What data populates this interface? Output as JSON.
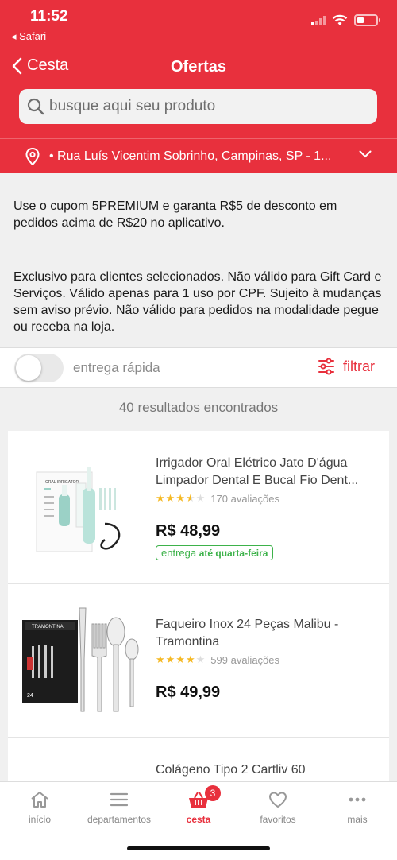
{
  "status_bar": {
    "time": "11:52",
    "back_app": "◂ Safari"
  },
  "nav": {
    "back_label": "Cesta",
    "title": "Ofertas"
  },
  "search": {
    "placeholder": "busque aqui seu produto"
  },
  "address": {
    "text": "•  Rua Luís Vicentim Sobrinho, Campinas, SP - 1..."
  },
  "promo": {
    "line1": "Use o cupom 5PREMIUM e garanta R$5 de desconto em pedidos acima de R$20 no aplicativo.",
    "line2": "Exclusivo para clientes selecionados. Não válido para Gift Card e Serviços. Válido apenas para 1 uso por CPF. Sujeito à mudanças sem aviso prévio. Não válido para pedidos na modalidade pegue ou receba na loja."
  },
  "filter": {
    "toggle_label": "entrega rápida",
    "filter_label": "filtrar",
    "toggle_on": false
  },
  "results_text": "40 resultados encontrados",
  "products": [
    {
      "name": "Irrigador Oral Elétrico Jato D'água Limpador Dental E Bucal Fio Dent...",
      "rating": 3.5,
      "reviews": "170 avaliações",
      "price": "R$ 48,99",
      "delivery_prefix": "entrega",
      "delivery_when": "até quarta-feira"
    },
    {
      "name": "Faqueiro Inox 24 Peças Malibu - Tramontina",
      "rating": 4,
      "reviews": "599 avaliações",
      "price": "R$ 49,99"
    },
    {
      "name": "Colágeno Tipo 2 Cartliv 60"
    }
  ],
  "box_label": "ORAL IRRIGATOR",
  "brand_label": "TRAMONTINA",
  "box_count": "24",
  "tabs": [
    {
      "label": "início",
      "icon": "home-icon"
    },
    {
      "label": "departamentos",
      "icon": "menu-icon"
    },
    {
      "label": "cesta",
      "icon": "basket-icon",
      "badge": "3",
      "active": true
    },
    {
      "label": "favoritos",
      "icon": "heart-icon"
    },
    {
      "label": "mais",
      "icon": "more-icon"
    }
  ],
  "colors": {
    "brand": "#e8303d",
    "delivery_green": "#3db24a",
    "star": "#f5b925"
  }
}
